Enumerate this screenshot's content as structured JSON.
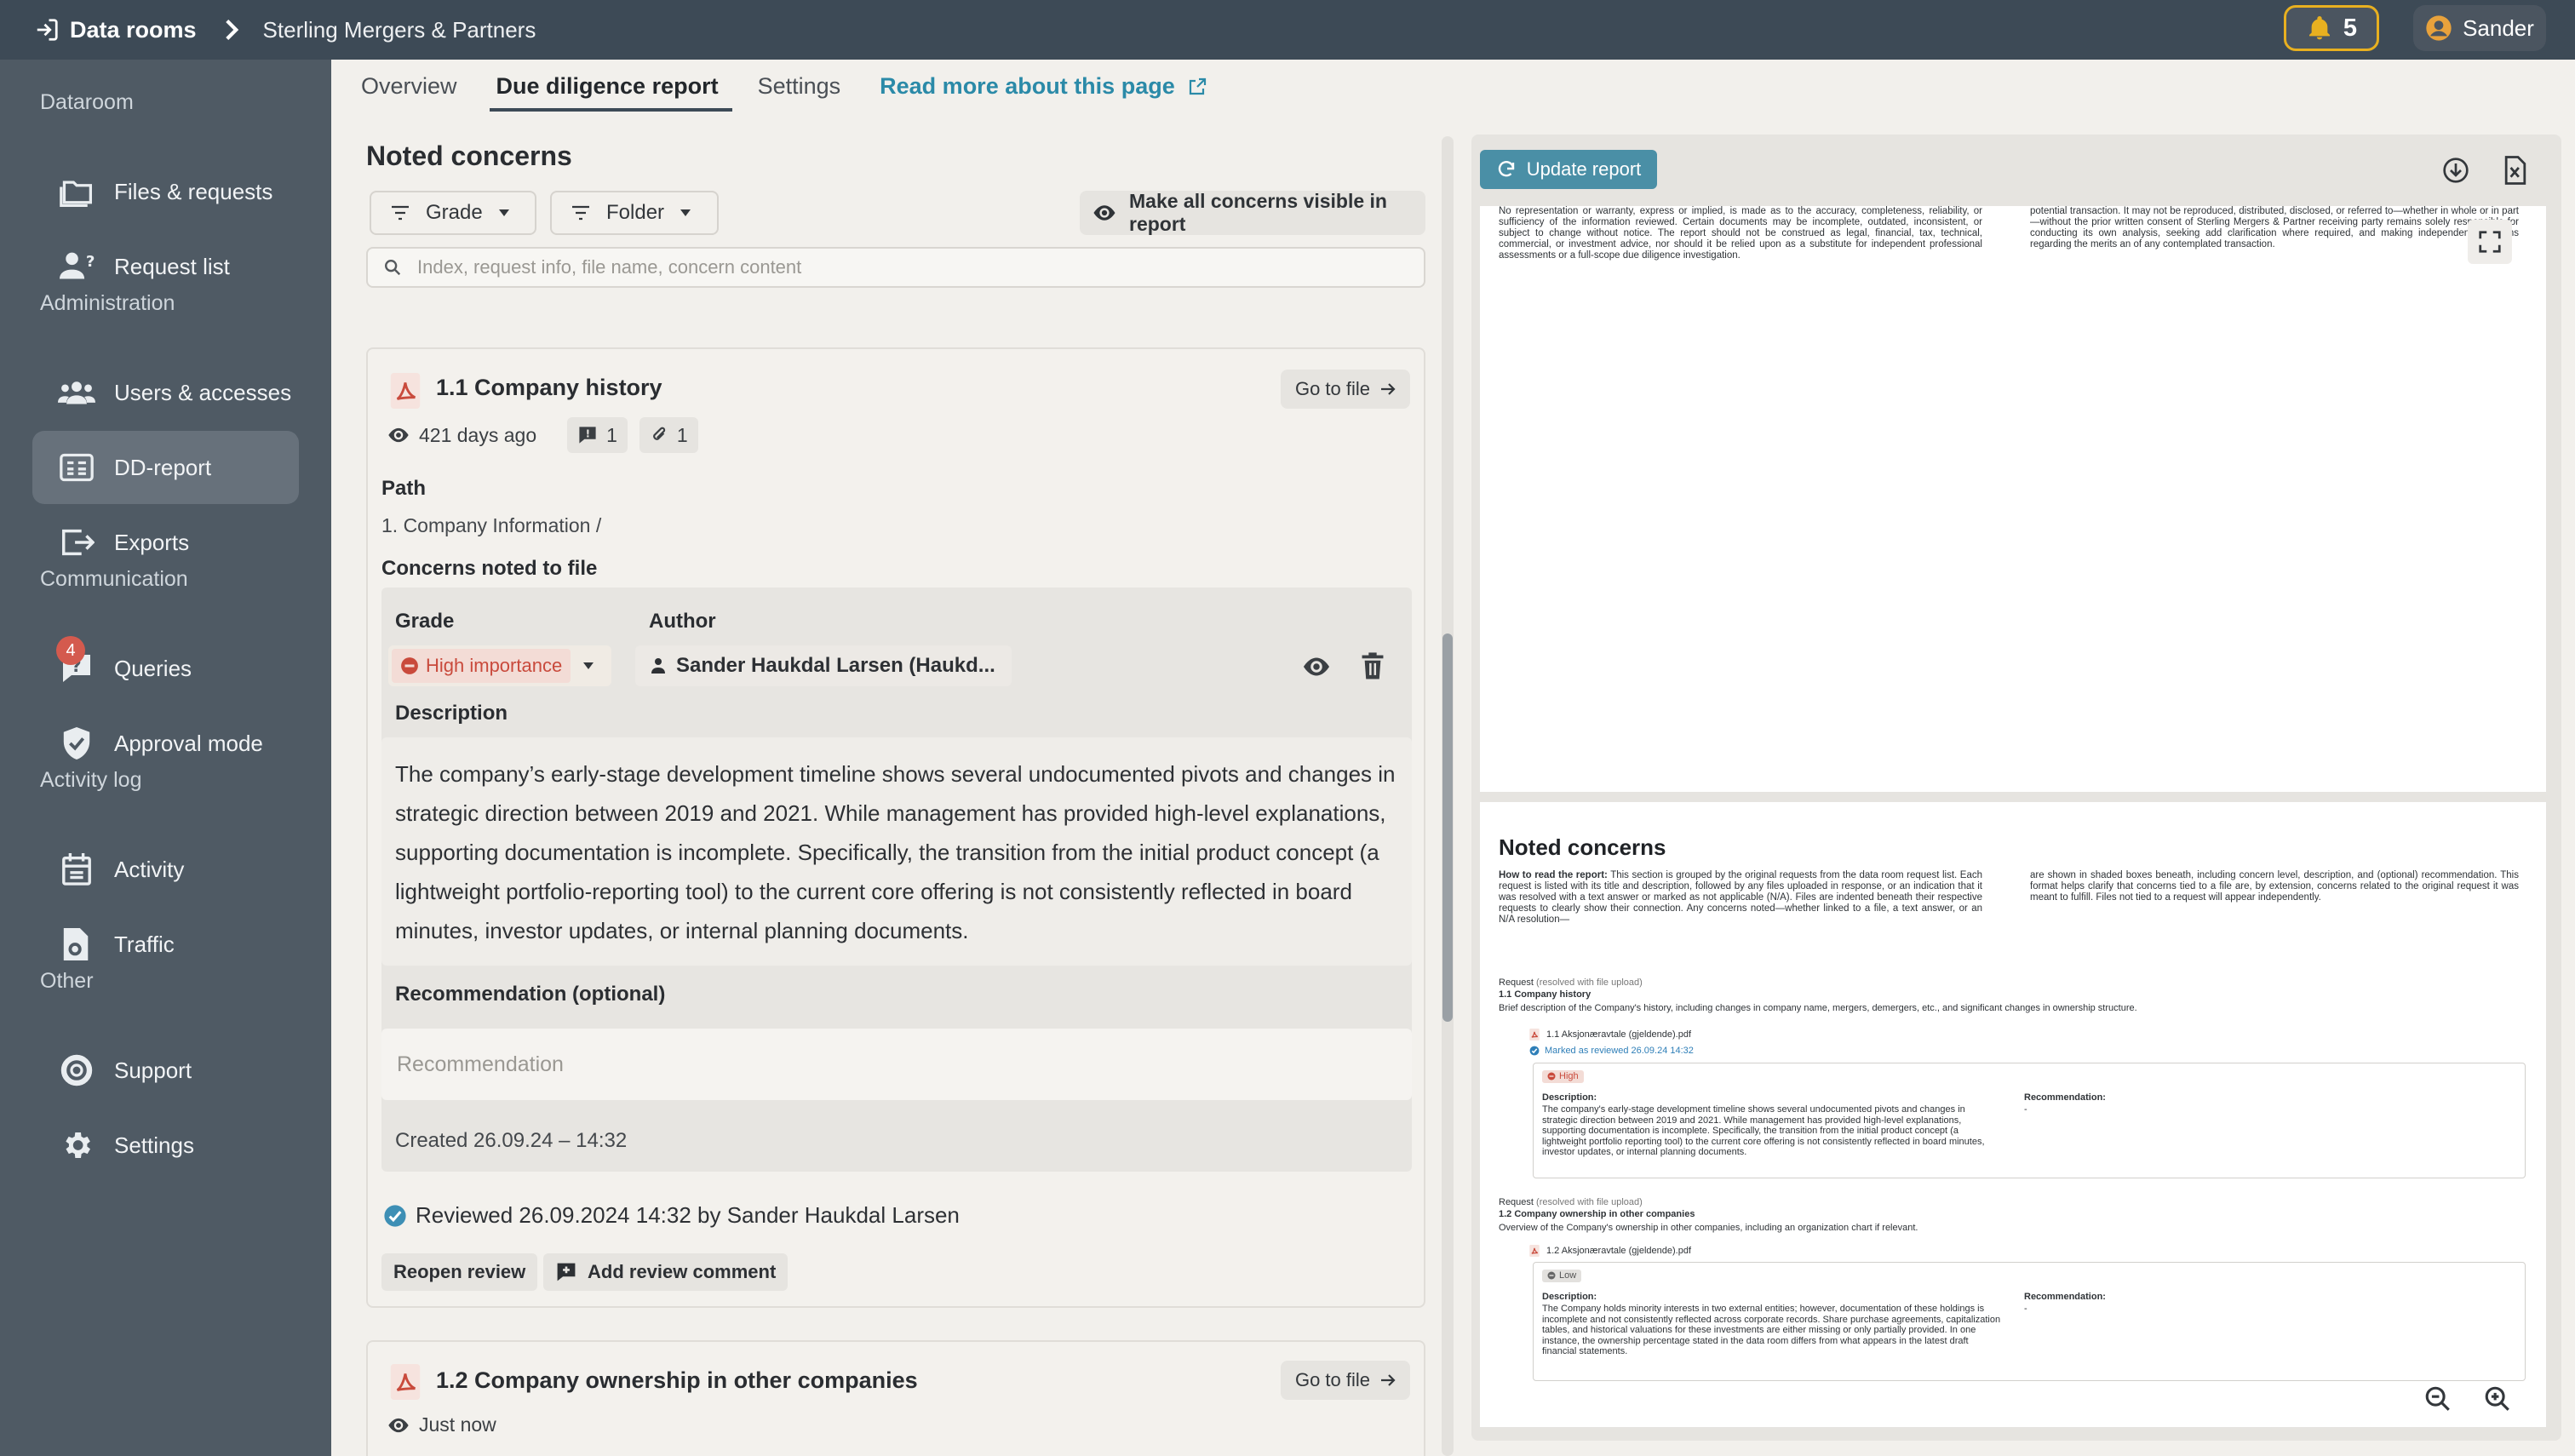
{
  "topbar": {
    "home_label": "Data rooms",
    "breadcrumb": "Sterling Mergers & Partners",
    "notifications_count": "5",
    "user_name": "Sander"
  },
  "sidebar": {
    "sections": {
      "dataroom": "Dataroom",
      "administration": "Administration",
      "communication": "Communication",
      "activity_log": "Activity log",
      "other": "Other"
    },
    "items": [
      {
        "label": "Files & requests",
        "icon": "folder-icon"
      },
      {
        "label": "Request list",
        "icon": "user-question-icon"
      },
      {
        "label": "Users & accesses",
        "icon": "users-icon"
      },
      {
        "label": "DD-report",
        "icon": "report-icon",
        "active": true
      },
      {
        "label": "Exports",
        "icon": "export-icon"
      },
      {
        "label": "Queries",
        "icon": "query-icon",
        "badge": "4"
      },
      {
        "label": "Approval mode",
        "icon": "shield-check-icon"
      },
      {
        "label": "Activity",
        "icon": "calendar-icon"
      },
      {
        "label": "Traffic",
        "icon": "traffic-icon"
      },
      {
        "label": "Support",
        "icon": "lifebuoy-icon"
      },
      {
        "label": "Settings",
        "icon": "gear-icon"
      }
    ]
  },
  "tabs": {
    "overview": "Overview",
    "dd_report": "Due diligence report",
    "settings": "Settings",
    "read_more": "Read more about this page"
  },
  "concerns": {
    "title": "Noted concerns",
    "filter_grade": "Grade",
    "filter_folder": "Folder",
    "make_visible": "Make all concerns visible in report",
    "search_placeholder": "Index, request info, file name, concern content"
  },
  "card1": {
    "title": "1.1 Company history",
    "goto": "Go to file",
    "viewed": "421 days ago",
    "comments": "1",
    "attachments": "1",
    "path_label": "Path",
    "path_value": "1. Company Information /",
    "concerns_label": "Concerns noted to file",
    "grade_label": "Grade",
    "grade_value": "High importance",
    "author_label": "Author",
    "author_value": "Sander Haukdal Larsen (Haukd...",
    "description_label": "Description",
    "description": "The company’s early-stage development timeline shows several undocumented pivots and changes in strategic direction between 2019 and 2021. While management has provided high-level explanations, supporting documentation is incomplete. Specifically, the transition from the initial product concept (a lightweight portfolio-reporting tool) to the current core offering is not consistently reflected in board minutes, investor updates, or internal planning documents.",
    "recommendation_label": "Recommendation (optional)",
    "recommendation_placeholder": "Recommendation",
    "created": "Created 26.09.24 – 14:32",
    "reviewed": "Reviewed 26.09.2024 14:32 by Sander Haukdal Larsen",
    "reopen": "Reopen review",
    "add_comment": "Add review comment"
  },
  "card2": {
    "title": "1.2 Company ownership in other companies",
    "goto": "Go to file",
    "viewed": "Just now"
  },
  "report": {
    "update_btn": "Update report",
    "disclaimer_left": "No representation or warranty, express or implied, is made as to the accuracy, completeness, reliability, or sufficiency of the information reviewed. Certain documents may be incomplete, outdated, inconsistent, or subject to change without notice. The report should not be construed as legal, financial, tax, technical, commercial, or investment advice, nor should it be relied upon as a substitute for independent professional assessments or a full-scope due diligence investigation.",
    "disclaimer_right": "potential transaction. It may not be reproduced, distributed, disclosed, or referred to—whether in whole or in part—without the prior written consent of Sterling Mergers & Partner receiving party remains solely responsible for conducting its own analysis, seeking add clarification where required, and making independent decisions regarding the merits an of any contemplated transaction.",
    "heading": "Noted concerns",
    "howto_bold": "How to read the report:",
    "howto_left": "This section is grouped by the original requests from the data room request list. Each request is listed with its title and description, followed by any files uploaded in response, or an indication that it was resolved with a text answer or marked as not applicable (N/A). Files are indented beneath their respective requests to clearly show their connection. Any concerns noted—whether linked to a file, a text answer, or an N/A resolution—",
    "howto_right": "are shown in shaded boxes beneath, including concern level, description, and (optional) recommendation. This format helps clarify that concerns tied to a file are, by extension, concerns related to the original request it was meant to fulfill. Files not tied to a request will appear independently.",
    "req1_label": "Request",
    "req1_status": "(resolved with file upload)",
    "req1_title": "1.1 Company history",
    "req1_desc": "Brief description of the Company's history, including changes in company name, mergers, demergers, etc., and significant changes in ownership structure.",
    "req1_file": "1.1 Aksjonæravtale (gjeldende).pdf",
    "req1_reviewed": "Marked as reviewed 26.09.24 14:32",
    "req1_grade": "High",
    "req1_desc_label": "Description:",
    "req1_concern": "The company's early-stage development timeline shows several undocumented pivots and changes in strategic direction between 2019 and 2021. While management has provided high-level explanations, supporting documentation is incomplete. Specifically, the transition from the initial product concept (a lightweight portfolio reporting tool) to the current core offering is not consistently reflected in board minutes, investor updates, or internal planning documents.",
    "req1_rec_label": "Recommendation:",
    "req1_rec": "-",
    "req2_label": "Request",
    "req2_status": "(resolved with file upload)",
    "req2_title": "1.2 Company ownership in other companies",
    "req2_desc": "Overview of the Company's ownership in other companies, including an organization chart if relevant.",
    "req2_file": "1.2 Aksjonæravtale (gjeldende).pdf",
    "req2_grade": "Low",
    "req2_desc_label": "Description:",
    "req2_concern": "The Company holds minority interests in two external entities; however, documentation of these holdings is incomplete and not consistently reflected across corporate records. Share purchase agreements, capitalization tables, and historical valuations for these investments are either missing or only partially provided. In one instance, the ownership percentage stated in the data room differs from what appears in the latest draft financial statements.",
    "req2_rec_label": "Recommendation:",
    "req2_rec": "-"
  },
  "colors": {
    "topbar": "#3d4a56",
    "sidebar": "#4f5a64",
    "accent": "#2b8aa8",
    "update_btn": "#4a8fa6",
    "high": "#c94a3c",
    "bell_border": "#e8b020"
  }
}
